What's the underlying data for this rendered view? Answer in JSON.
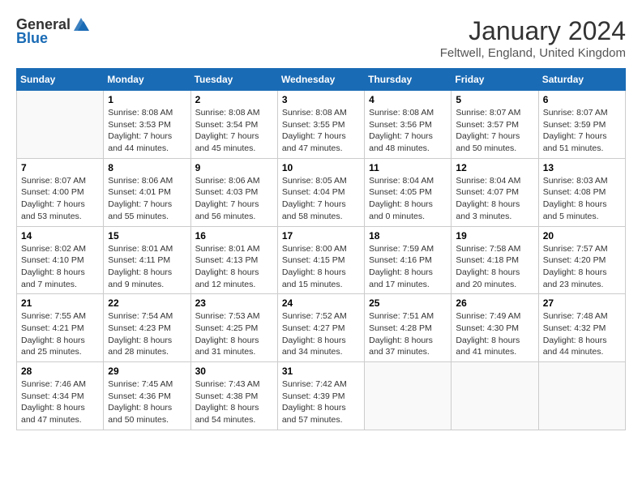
{
  "header": {
    "logo_general": "General",
    "logo_blue": "Blue",
    "month": "January 2024",
    "location": "Feltwell, England, United Kingdom"
  },
  "days_of_week": [
    "Sunday",
    "Monday",
    "Tuesday",
    "Wednesday",
    "Thursday",
    "Friday",
    "Saturday"
  ],
  "weeks": [
    [
      {
        "day": "",
        "info": ""
      },
      {
        "day": "1",
        "info": "Sunrise: 8:08 AM\nSunset: 3:53 PM\nDaylight: 7 hours\nand 44 minutes."
      },
      {
        "day": "2",
        "info": "Sunrise: 8:08 AM\nSunset: 3:54 PM\nDaylight: 7 hours\nand 45 minutes."
      },
      {
        "day": "3",
        "info": "Sunrise: 8:08 AM\nSunset: 3:55 PM\nDaylight: 7 hours\nand 47 minutes."
      },
      {
        "day": "4",
        "info": "Sunrise: 8:08 AM\nSunset: 3:56 PM\nDaylight: 7 hours\nand 48 minutes."
      },
      {
        "day": "5",
        "info": "Sunrise: 8:07 AM\nSunset: 3:57 PM\nDaylight: 7 hours\nand 50 minutes."
      },
      {
        "day": "6",
        "info": "Sunrise: 8:07 AM\nSunset: 3:59 PM\nDaylight: 7 hours\nand 51 minutes."
      }
    ],
    [
      {
        "day": "7",
        "info": "Sunrise: 8:07 AM\nSunset: 4:00 PM\nDaylight: 7 hours\nand 53 minutes."
      },
      {
        "day": "8",
        "info": "Sunrise: 8:06 AM\nSunset: 4:01 PM\nDaylight: 7 hours\nand 55 minutes."
      },
      {
        "day": "9",
        "info": "Sunrise: 8:06 AM\nSunset: 4:03 PM\nDaylight: 7 hours\nand 56 minutes."
      },
      {
        "day": "10",
        "info": "Sunrise: 8:05 AM\nSunset: 4:04 PM\nDaylight: 7 hours\nand 58 minutes."
      },
      {
        "day": "11",
        "info": "Sunrise: 8:04 AM\nSunset: 4:05 PM\nDaylight: 8 hours\nand 0 minutes."
      },
      {
        "day": "12",
        "info": "Sunrise: 8:04 AM\nSunset: 4:07 PM\nDaylight: 8 hours\nand 3 minutes."
      },
      {
        "day": "13",
        "info": "Sunrise: 8:03 AM\nSunset: 4:08 PM\nDaylight: 8 hours\nand 5 minutes."
      }
    ],
    [
      {
        "day": "14",
        "info": "Sunrise: 8:02 AM\nSunset: 4:10 PM\nDaylight: 8 hours\nand 7 minutes."
      },
      {
        "day": "15",
        "info": "Sunrise: 8:01 AM\nSunset: 4:11 PM\nDaylight: 8 hours\nand 9 minutes."
      },
      {
        "day": "16",
        "info": "Sunrise: 8:01 AM\nSunset: 4:13 PM\nDaylight: 8 hours\nand 12 minutes."
      },
      {
        "day": "17",
        "info": "Sunrise: 8:00 AM\nSunset: 4:15 PM\nDaylight: 8 hours\nand 15 minutes."
      },
      {
        "day": "18",
        "info": "Sunrise: 7:59 AM\nSunset: 4:16 PM\nDaylight: 8 hours\nand 17 minutes."
      },
      {
        "day": "19",
        "info": "Sunrise: 7:58 AM\nSunset: 4:18 PM\nDaylight: 8 hours\nand 20 minutes."
      },
      {
        "day": "20",
        "info": "Sunrise: 7:57 AM\nSunset: 4:20 PM\nDaylight: 8 hours\nand 23 minutes."
      }
    ],
    [
      {
        "day": "21",
        "info": "Sunrise: 7:55 AM\nSunset: 4:21 PM\nDaylight: 8 hours\nand 25 minutes."
      },
      {
        "day": "22",
        "info": "Sunrise: 7:54 AM\nSunset: 4:23 PM\nDaylight: 8 hours\nand 28 minutes."
      },
      {
        "day": "23",
        "info": "Sunrise: 7:53 AM\nSunset: 4:25 PM\nDaylight: 8 hours\nand 31 minutes."
      },
      {
        "day": "24",
        "info": "Sunrise: 7:52 AM\nSunset: 4:27 PM\nDaylight: 8 hours\nand 34 minutes."
      },
      {
        "day": "25",
        "info": "Sunrise: 7:51 AM\nSunset: 4:28 PM\nDaylight: 8 hours\nand 37 minutes."
      },
      {
        "day": "26",
        "info": "Sunrise: 7:49 AM\nSunset: 4:30 PM\nDaylight: 8 hours\nand 41 minutes."
      },
      {
        "day": "27",
        "info": "Sunrise: 7:48 AM\nSunset: 4:32 PM\nDaylight: 8 hours\nand 44 minutes."
      }
    ],
    [
      {
        "day": "28",
        "info": "Sunrise: 7:46 AM\nSunset: 4:34 PM\nDaylight: 8 hours\nand 47 minutes."
      },
      {
        "day": "29",
        "info": "Sunrise: 7:45 AM\nSunset: 4:36 PM\nDaylight: 8 hours\nand 50 minutes."
      },
      {
        "day": "30",
        "info": "Sunrise: 7:43 AM\nSunset: 4:38 PM\nDaylight: 8 hours\nand 54 minutes."
      },
      {
        "day": "31",
        "info": "Sunrise: 7:42 AM\nSunset: 4:39 PM\nDaylight: 8 hours\nand 57 minutes."
      },
      {
        "day": "",
        "info": ""
      },
      {
        "day": "",
        "info": ""
      },
      {
        "day": "",
        "info": ""
      }
    ]
  ]
}
